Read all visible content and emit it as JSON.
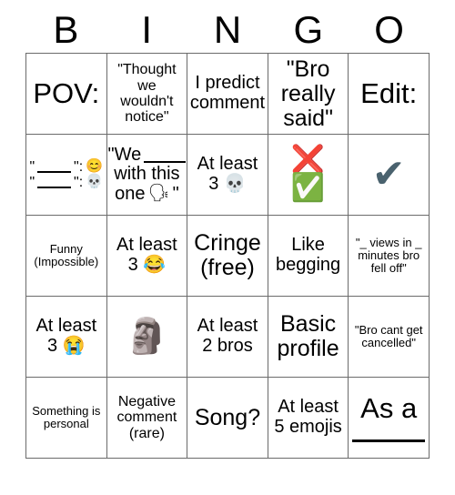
{
  "header": {
    "letters": [
      "B",
      "I",
      "N",
      "G",
      "O"
    ]
  },
  "colors": {
    "grid_line": "#6b6b6b",
    "background": "#ffffff",
    "text": "#000000",
    "cross_mark_red": "#e8453c",
    "check_button_green": "#5fb14f",
    "heavy_check_gray": "#4a626e"
  },
  "grid": {
    "columns": 5,
    "rows": 5,
    "cells": [
      [
        {
          "id": "b1",
          "type": "text",
          "text": "POV:",
          "size": "sz-xl"
        },
        {
          "id": "i1",
          "type": "text",
          "text": "\"Thought we wouldn't notice\"",
          "size": "sz-s"
        },
        {
          "id": "n1",
          "type": "text",
          "text": "I predict comment",
          "size": "sz-m"
        },
        {
          "id": "g1",
          "type": "text",
          "text": "\"Bro really said\"",
          "size": "sz-l"
        },
        {
          "id": "o1",
          "type": "text",
          "text": "Edit:",
          "size": "sz-xl"
        }
      ],
      [
        {
          "id": "b2",
          "type": "blank-emoji-pair",
          "line1_quote_open": "\"",
          "line1_quote_close": "\":",
          "line1_emoji": "😊",
          "line1_emoji_name": "smiling-face-with-smiling-eyes-emoji",
          "line2_quote_open": "\"",
          "line2_quote_close": "\":",
          "line2_emoji": "💀",
          "line2_emoji_name": "skull-emoji",
          "size": "sz-s"
        },
        {
          "id": "i2",
          "type": "text-blank",
          "prefix": "\"We",
          "middle": "with this",
          "suffix": "one",
          "emoji": "🗣",
          "emoji_name": "speaking-head-emoji",
          "end_quote": "\"",
          "size": "sz-m"
        },
        {
          "id": "n2",
          "type": "text",
          "text": "At least 3 💀",
          "size": "sz-m"
        },
        {
          "id": "g2",
          "type": "emoji-stack",
          "emojis": [
            "❌",
            "✅"
          ],
          "emoji_names": [
            "cross-mark-emoji",
            "check-mark-button-emoji"
          ]
        },
        {
          "id": "o2",
          "type": "heavy-check",
          "emoji": "✔",
          "emoji_name": "heavy-check-mark-icon"
        }
      ],
      [
        {
          "id": "b3",
          "type": "text",
          "text": "Funny (Impossible)",
          "size": "sz-xs"
        },
        {
          "id": "i3",
          "type": "text",
          "text": "At least 3 😂",
          "size": "sz-m"
        },
        {
          "id": "n3",
          "type": "text",
          "text": "Cringe (free)",
          "size": "sz-l"
        },
        {
          "id": "g3",
          "type": "text",
          "text": "Like begging",
          "size": "sz-m"
        },
        {
          "id": "o3",
          "type": "text",
          "text": "\"_ views in _ minutes bro fell off\"",
          "size": "sz-xs"
        }
      ],
      [
        {
          "id": "b4",
          "type": "text",
          "text": "At least 3 😭",
          "size": "sz-m"
        },
        {
          "id": "i4",
          "type": "emoji-only",
          "emoji": "🗿",
          "emoji_name": "moai-emoji"
        },
        {
          "id": "n4",
          "type": "text",
          "text": "At least 2 bros",
          "size": "sz-m"
        },
        {
          "id": "g4",
          "type": "text",
          "text": "Basic profile",
          "size": "sz-l"
        },
        {
          "id": "o4",
          "type": "text",
          "text": "\"Bro cant get cancelled\"",
          "size": "sz-xs"
        }
      ],
      [
        {
          "id": "b5",
          "type": "text",
          "text": "Something is personal",
          "size": "sz-xs"
        },
        {
          "id": "i5",
          "type": "text",
          "text": "Negative comment (rare)",
          "size": "sz-s"
        },
        {
          "id": "n5",
          "type": "text",
          "text": "Song?",
          "size": "sz-l"
        },
        {
          "id": "g5",
          "type": "text",
          "text": "At least 5 emojis",
          "size": "sz-m"
        },
        {
          "id": "o5",
          "type": "text-underline",
          "text": "As a",
          "size": "sz-xl"
        }
      ]
    ]
  }
}
